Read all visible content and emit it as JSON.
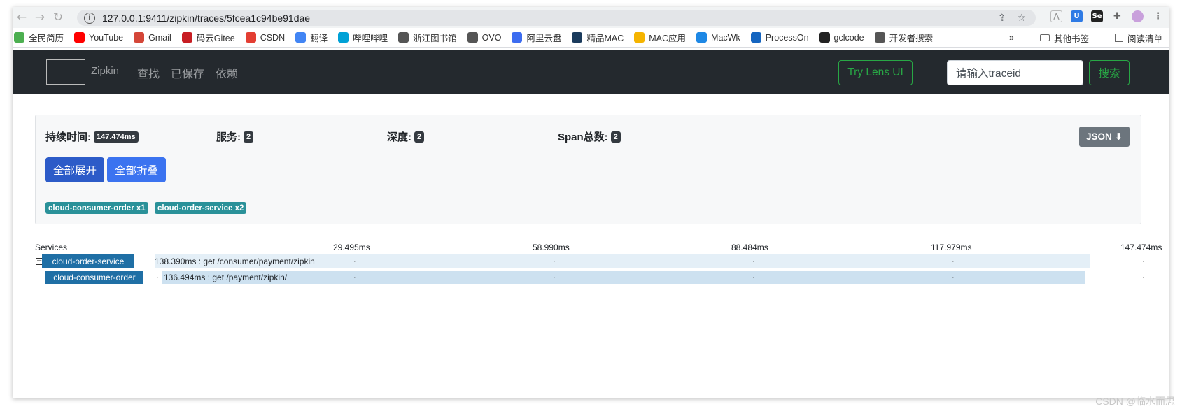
{
  "browser": {
    "url": "127.0.0.1:9411/zipkin/traces/5fcea1c94be91dae",
    "bookmarks": [
      {
        "label": "全民简历",
        "icon": "resume-icon",
        "color": "#4caf50"
      },
      {
        "label": "YouTube",
        "icon": "youtube-icon",
        "color": "#ff0000"
      },
      {
        "label": "Gmail",
        "icon": "gmail-icon",
        "color": "#d44638"
      },
      {
        "label": "码云Gitee",
        "icon": "gitee-icon",
        "color": "#c71d23"
      },
      {
        "label": "CSDN",
        "icon": "csdn-icon",
        "color": "#e33e33"
      },
      {
        "label": "翻译",
        "icon": "translate-icon",
        "color": "#4285f4"
      },
      {
        "label": "哔哩哔哩",
        "icon": "bilibili-icon",
        "color": "#00a1d6"
      },
      {
        "label": "浙江图书馆",
        "icon": "globe-icon",
        "color": "#555555"
      },
      {
        "label": "OVO",
        "icon": "globe-icon",
        "color": "#555555"
      },
      {
        "label": "阿里云盘",
        "icon": "aliyun-drive-icon",
        "color": "#3c6cf0"
      },
      {
        "label": "精品MAC",
        "icon": "mac-x-icon",
        "color": "#1a3a5c"
      },
      {
        "label": "MAC应用",
        "icon": "pineapple-icon",
        "color": "#f5b400"
      },
      {
        "label": "MacWk",
        "icon": "macwk-icon",
        "color": "#1e88e5"
      },
      {
        "label": "ProcessOn",
        "icon": "processon-icon",
        "color": "#1565c0"
      },
      {
        "label": "gclcode",
        "icon": "github-icon",
        "color": "#222222"
      },
      {
        "label": "开发者搜索",
        "icon": "globe-icon",
        "color": "#555555"
      }
    ],
    "more_bookmarks": "»",
    "other_bookmarks": "其他书签",
    "reading_list": "阅读清单"
  },
  "navbar": {
    "brand": "Zipkin",
    "links": [
      "查找",
      "已保存",
      "依赖"
    ],
    "lens_button": "Try Lens UI",
    "search_placeholder": "请输入traceid",
    "search_button": "搜索"
  },
  "summary": {
    "duration_label": "持续时间:",
    "duration_value": "147.474ms",
    "services_label": "服务:",
    "services_value": "2",
    "depth_label": "深度:",
    "depth_value": "2",
    "spans_label": "Span总数:",
    "spans_value": "2",
    "json_button": "JSON",
    "expand_all": "全部展开",
    "collapse_all": "全部折叠",
    "service_badges": [
      "cloud-consumer-order x1",
      "cloud-order-service x2"
    ]
  },
  "timeline": {
    "services_header": "Services",
    "ticks": [
      "29.495ms",
      "58.990ms",
      "88.484ms",
      "117.979ms",
      "147.474ms"
    ],
    "spans": [
      {
        "service": "cloud-order-service",
        "text": "138.390ms : get /consumer/payment/zipkin",
        "depth": 0
      },
      {
        "service": "cloud-consumer-order",
        "text": "136.494ms : get /payment/zipkin/",
        "depth": 1
      }
    ]
  },
  "watermark": "CSDN @临水而思"
}
